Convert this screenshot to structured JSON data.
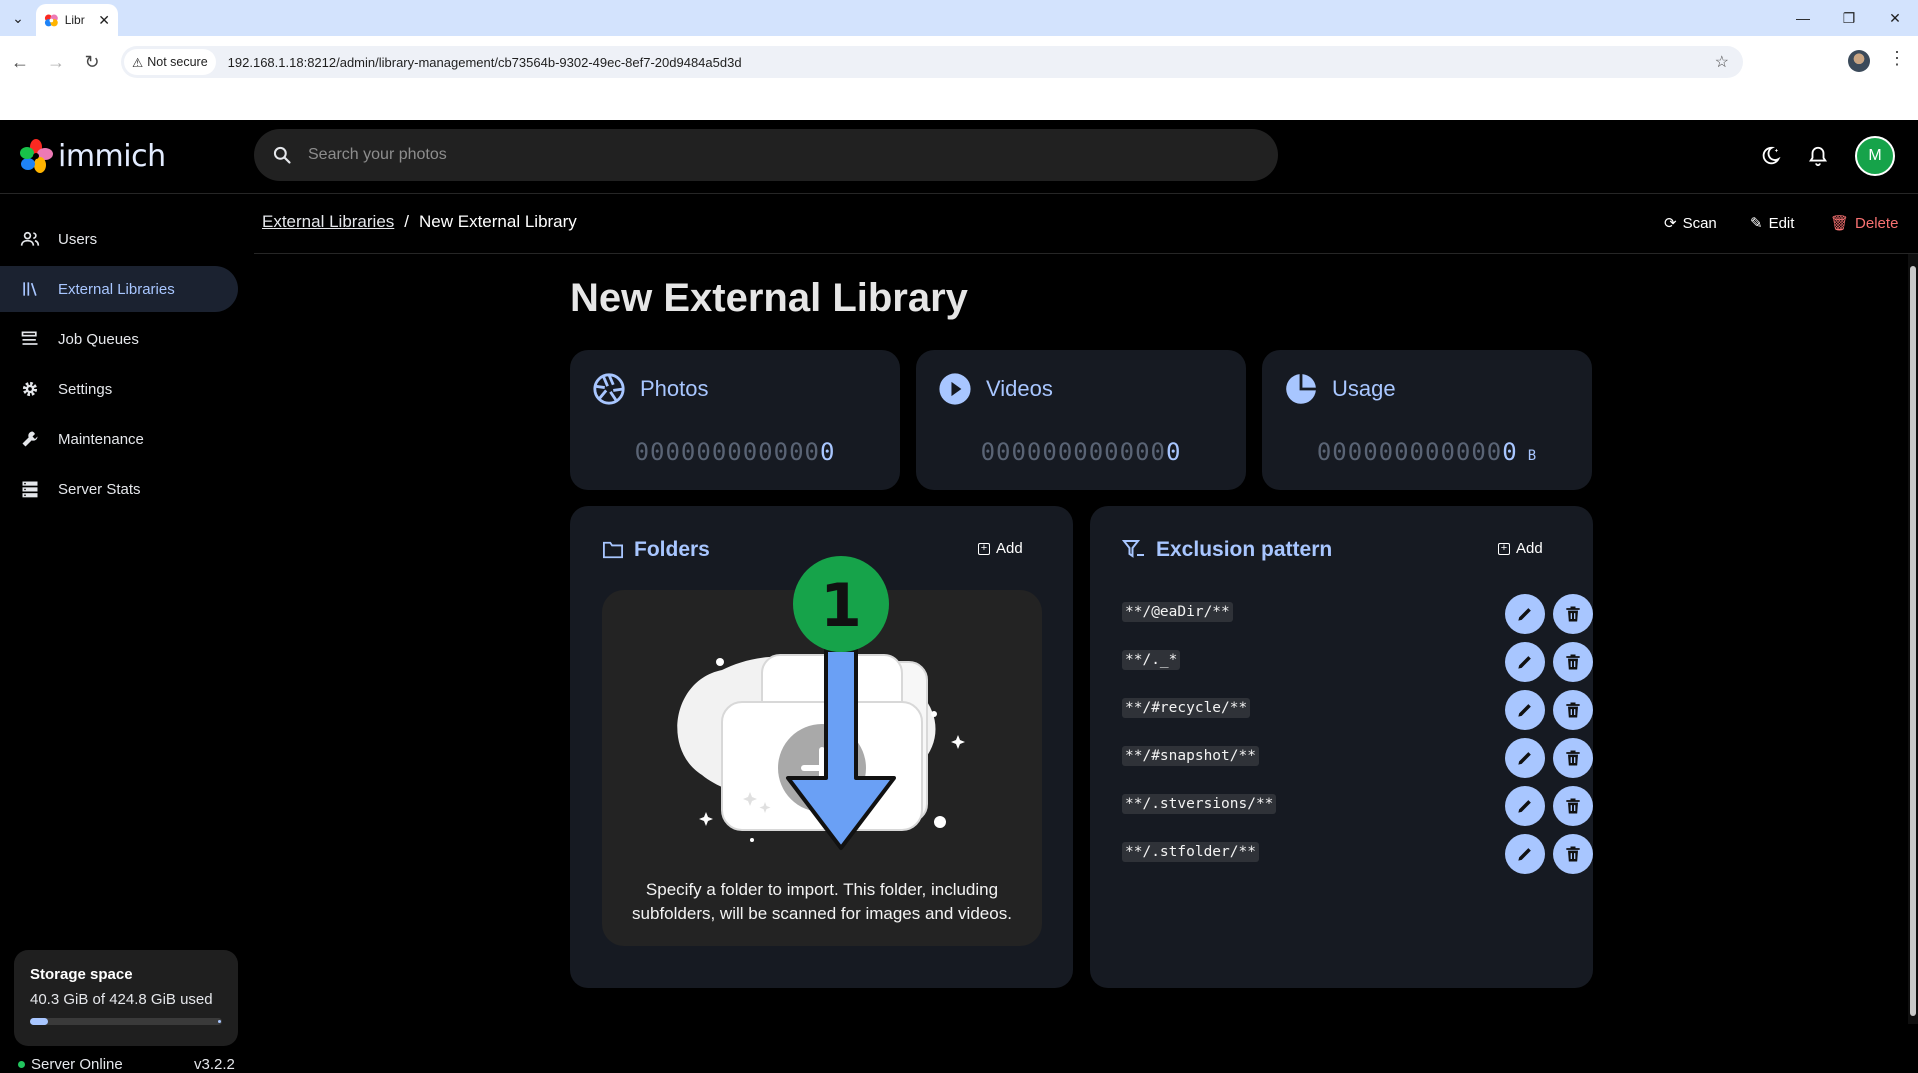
{
  "browser": {
    "tab_title": "Libr",
    "not_secure": "Not secure",
    "url": "192.168.1.18:8212/admin/library-management/cb73564b-9302-49ec-8ef7-20d9484a5d3d"
  },
  "app": {
    "logo_text": "immich",
    "search_placeholder": "Search your photos",
    "avatar_letter": "M"
  },
  "sidebar": {
    "items": [
      {
        "label": "Users",
        "icon": "users-icon"
      },
      {
        "label": "External Libraries",
        "icon": "library-icon",
        "active": true
      },
      {
        "label": "Job Queues",
        "icon": "queue-icon"
      },
      {
        "label": "Settings",
        "icon": "gear-icon"
      },
      {
        "label": "Maintenance",
        "icon": "wrench-icon"
      },
      {
        "label": "Server Stats",
        "icon": "server-icon"
      }
    ],
    "storage_title": "Storage space",
    "storage_used": "40.3 GiB of 424.8 GiB used",
    "storage_fraction": 0.095,
    "server_status": "Server Online",
    "version": "v3.2.2"
  },
  "header": {
    "breadcrumb_parent": "External Libraries",
    "breadcrumb_separator": "/",
    "breadcrumb_current": "New External Library",
    "scan": "Scan",
    "edit": "Edit",
    "delete": "Delete"
  },
  "page": {
    "title": "New External Library",
    "stats": [
      {
        "label": "Photos",
        "zeros": "000000000000",
        "value": "0",
        "unit": ""
      },
      {
        "label": "Videos",
        "zeros": "000000000000",
        "value": "0",
        "unit": ""
      },
      {
        "label": "Usage",
        "zeros": "000000000000",
        "value": "0",
        "unit": "B"
      }
    ],
    "folders": {
      "title": "Folders",
      "add": "Add",
      "empty_text": "Specify a folder to import. This folder, including subfolders, will be scanned for images and videos."
    },
    "exclusion": {
      "title": "Exclusion pattern",
      "add": "Add",
      "patterns": [
        "**/@eaDir/**",
        "**/._*",
        "**/#recycle/**",
        "**/#snapshot/**",
        "**/.stversions/**",
        "**/.stfolder/**"
      ]
    },
    "annotation_number": "1"
  },
  "colors": {
    "accent": "#a8c6ff",
    "delete": "#f87171",
    "avatar": "#16a34a",
    "annotation_circle": "#16a34a",
    "annotation_arrow": "#6aa0f5"
  }
}
